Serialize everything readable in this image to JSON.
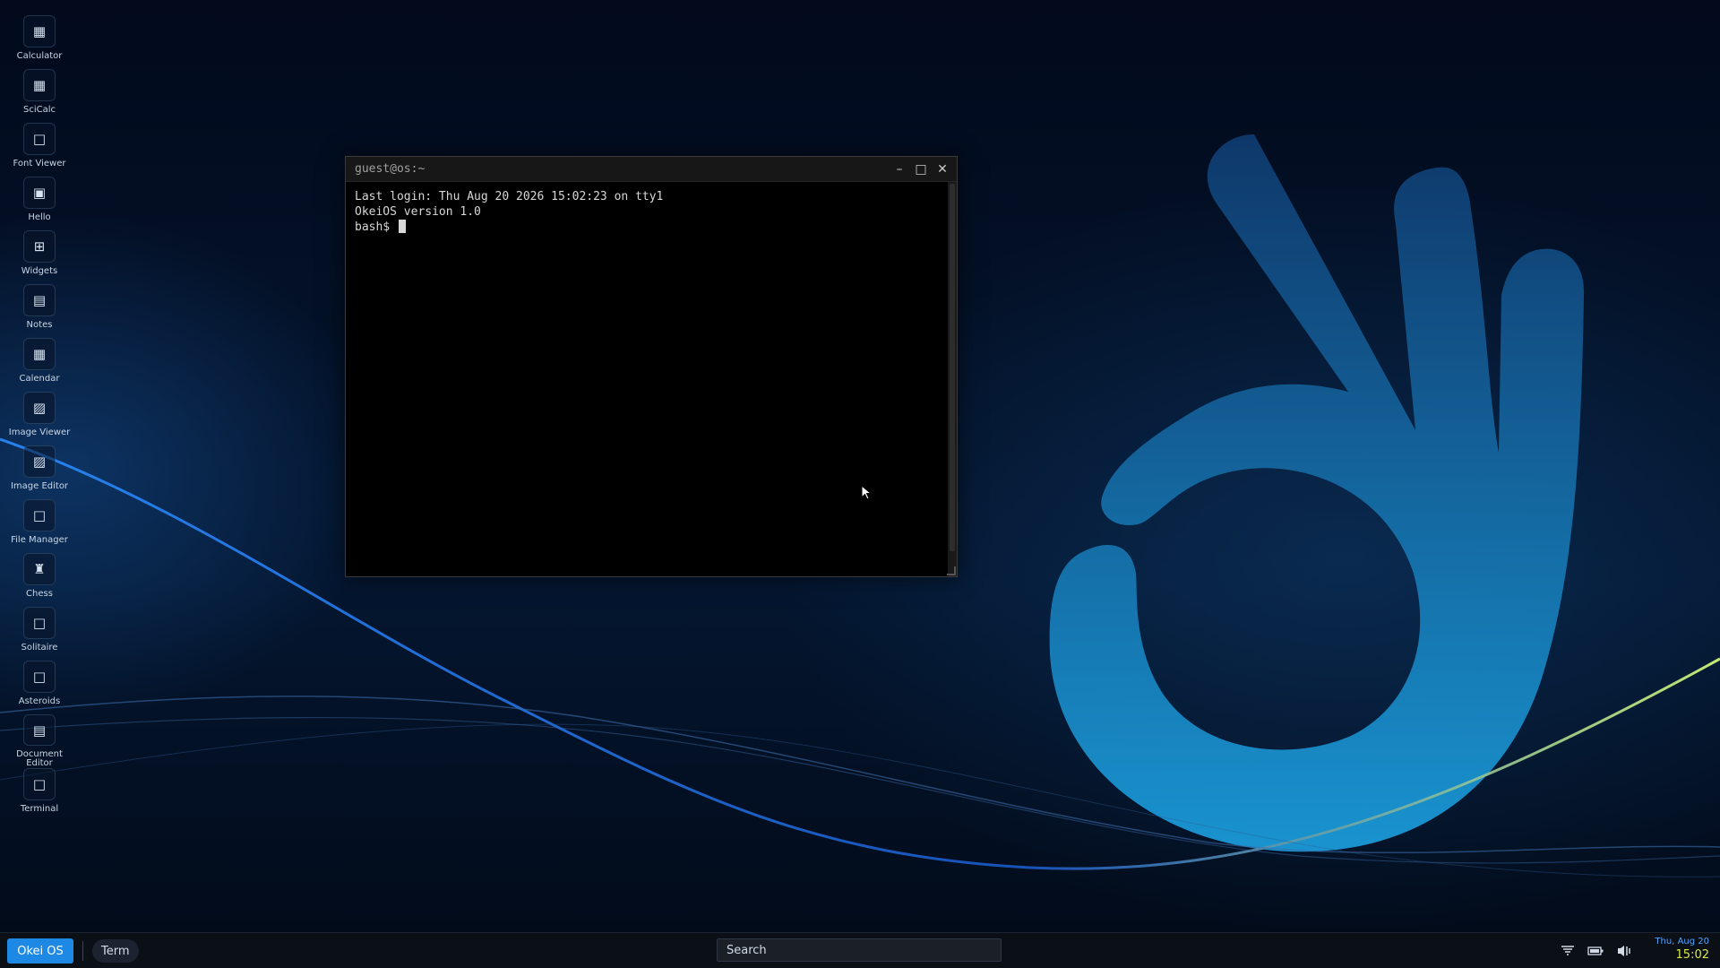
{
  "desktop_icons": [
    {
      "label": "Calculator",
      "icon": "calculator-icon"
    },
    {
      "label": "SciCalc",
      "icon": "calculator-icon"
    },
    {
      "label": "Font Viewer",
      "icon": "font-viewer-icon"
    },
    {
      "label": "Hello",
      "icon": "hello-icon"
    },
    {
      "label": "Widgets",
      "icon": "widgets-icon"
    },
    {
      "label": "Notes",
      "icon": "notes-icon"
    },
    {
      "label": "Calendar",
      "icon": "calendar-icon"
    },
    {
      "label": "Image Viewer",
      "icon": "image-icon"
    },
    {
      "label": "Image Editor",
      "icon": "image-icon"
    },
    {
      "label": "File Manager",
      "icon": "file-manager-icon"
    },
    {
      "label": "Chess",
      "icon": "chess-icon"
    },
    {
      "label": "Solitaire",
      "icon": "solitaire-icon"
    },
    {
      "label": "Asteroids",
      "icon": "asteroids-icon"
    },
    {
      "label": "Document Editor",
      "icon": "document-icon"
    },
    {
      "label": "Terminal",
      "icon": "terminal-icon"
    }
  ],
  "terminal": {
    "title": "guest@os:~",
    "lines": [
      "Last login: Thu Aug 20 2026 15:02:23 on tty1",
      "OkeiOS version 1.0"
    ],
    "prompt": "bash$ "
  },
  "taskbar": {
    "start_label": "Okei OS",
    "task_label": "Term",
    "search_text": "Search",
    "clock_date": "Thu, Aug 20",
    "clock_time": "15:02"
  },
  "colors": {
    "accent": "#1e88e5",
    "clock_time": "#d7e94a",
    "clock_date": "#4fa3ff"
  }
}
